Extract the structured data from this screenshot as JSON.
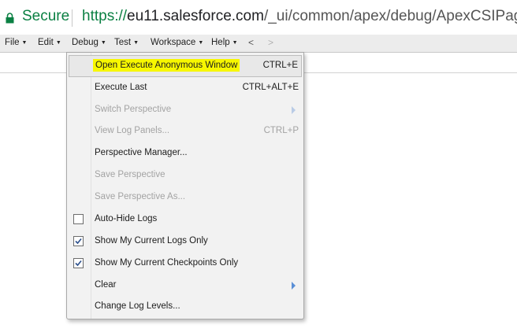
{
  "browser": {
    "secure_label": "Secure",
    "url_scheme": "https://",
    "url_host": "eu11.salesforce.com",
    "url_path": "/_ui/common/apex/debug/ApexCSIPage"
  },
  "menubar": {
    "items": [
      "File",
      "Edit",
      "Debug",
      "Test",
      "Workspace",
      "Help"
    ],
    "back": "<",
    "forward": ">"
  },
  "debug_menu": {
    "items": [
      {
        "label": "Open Execute Anonymous Window",
        "shortcut": "CTRL+E",
        "enabled": true,
        "highlighted": true
      },
      {
        "label": "Execute Last",
        "shortcut": "CTRL+ALT+E",
        "enabled": true
      },
      {
        "label": "Switch Perspective",
        "shortcut": "",
        "enabled": false,
        "submenu": true
      },
      {
        "label": "View Log Panels...",
        "shortcut": "CTRL+P",
        "enabled": false
      },
      {
        "label": "Perspective Manager...",
        "shortcut": "",
        "enabled": true
      },
      {
        "label": "Save Perspective",
        "shortcut": "",
        "enabled": false
      },
      {
        "label": "Save Perspective As...",
        "shortcut": "",
        "enabled": false
      },
      {
        "label": "Auto-Hide Logs",
        "shortcut": "",
        "enabled": true,
        "checkbox": true,
        "checked": false
      },
      {
        "label": "Show My Current Logs Only",
        "shortcut": "",
        "enabled": true,
        "checkbox": true,
        "checked": true
      },
      {
        "label": "Show My Current Checkpoints Only",
        "shortcut": "",
        "enabled": true,
        "checkbox": true,
        "checked": true
      },
      {
        "label": "Clear",
        "shortcut": "",
        "enabled": true,
        "submenu": true
      },
      {
        "label": "Change Log Levels...",
        "shortcut": "",
        "enabled": true
      }
    ]
  },
  "colors": {
    "secure_green": "#0b8043",
    "highlight_yellow": "#f7f700",
    "submenu_arrow": "#5a8fd6"
  }
}
